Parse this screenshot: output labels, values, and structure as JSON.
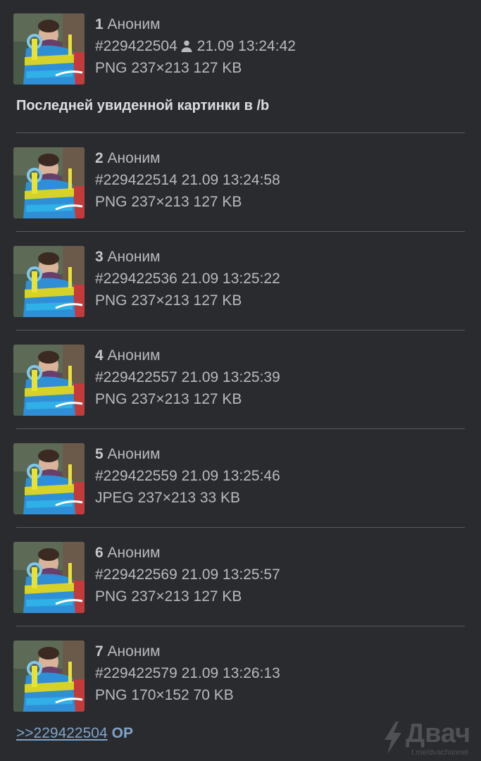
{
  "posts": [
    {
      "num": "1",
      "name": "Аноним",
      "id": "#229422504",
      "date": "21.09 13:24:42",
      "file": "PNG 237×213 127 KB",
      "op": true
    },
    {
      "num": "2",
      "name": "Аноним",
      "id": "#229422514",
      "date": "21.09 13:24:58",
      "file": "PNG 237×213 127 KB"
    },
    {
      "num": "3",
      "name": "Аноним",
      "id": "#229422536",
      "date": "21.09 13:25:22",
      "file": "PNG 237×213 127 KB"
    },
    {
      "num": "4",
      "name": "Аноним",
      "id": "#229422557",
      "date": "21.09 13:25:39",
      "file": "PNG 237×213 127 KB"
    },
    {
      "num": "5",
      "name": "Аноним",
      "id": "#229422559",
      "date": "21.09 13:25:46",
      "file": "JPEG 237×213 33 KB"
    },
    {
      "num": "6",
      "name": "Аноним",
      "id": "#229422569",
      "date": "21.09 13:25:57",
      "file": "PNG 237×213 127 KB"
    },
    {
      "num": "7",
      "name": "Аноним",
      "id": "#229422579",
      "date": "21.09 13:26:13",
      "file": "PNG 170×152 70 KB"
    }
  ],
  "first_comment": "Последней увиденной картинки в /b",
  "reply": {
    "link": ">>229422504",
    "op_label": "OP"
  },
  "watermark": {
    "title": "Двач",
    "subtitle": "t.me/dvachannel"
  },
  "icons": {
    "op_marker": "person-icon",
    "watermark": "lightning-icon"
  },
  "colors": {
    "background": "#2a2b2f",
    "text": "#b9babd",
    "link": "#7fa3c9",
    "separator": "#5a5b5f"
  }
}
